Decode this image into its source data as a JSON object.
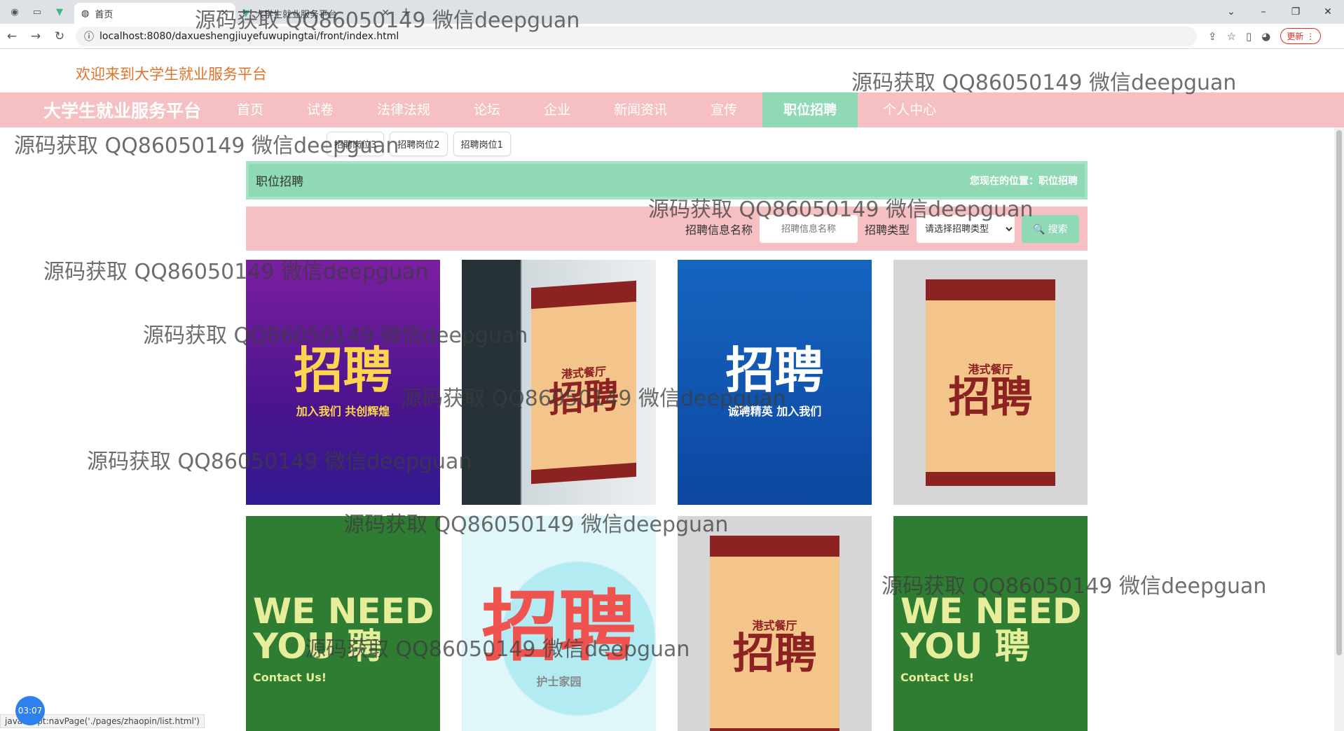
{
  "browser": {
    "active_tab": "首页",
    "inactive_tab": "大学生就业服务平台",
    "url": "localhost:8080/daxueshengjiuyefuwupingtai/front/index.html",
    "update_label": "更新"
  },
  "header": {
    "welcome": "欢迎来到大学生就业服务平台",
    "brand": "大学生就业服务平台"
  },
  "nav": [
    "首页",
    "试卷",
    "法律法规",
    "论坛",
    "企业",
    "新闻资讯",
    "宣传",
    "职位招聘",
    "个人中心"
  ],
  "tags": [
    "招聘岗位3",
    "招聘岗位2",
    "招聘岗位1"
  ],
  "title_bar": {
    "title": "职位招聘",
    "location": "您现在的位置：职位招聘"
  },
  "search": {
    "name_label": "招聘信息名称",
    "name_placeholder": "招聘信息名称",
    "type_label": "招聘类型",
    "type_selected": "请选择招聘类型",
    "button": "搜索"
  },
  "posters": [
    {
      "big": "招聘",
      "small": "加入我们 共创辉煌"
    },
    {
      "big": "招聘",
      "small": "港式餐厅"
    },
    {
      "big": "招聘",
      "small": "诚聘精英 加入我们"
    },
    {
      "big": "招聘",
      "small": "港式餐厅"
    },
    {
      "big": "WE NEED YOU 聘",
      "small": "Contact Us!"
    },
    {
      "big": "招聘",
      "small": "护士家园"
    },
    {
      "big": "招聘",
      "small": "港式餐厅"
    },
    {
      "big": "WE NEED YOU 聘",
      "small": "Contact Us!"
    }
  ],
  "status_url": "javascript:navPage('./pages/zhaopin/list.html')",
  "timer": "03:07",
  "watermark": "源码获取 QQ86050149 微信deepguan"
}
